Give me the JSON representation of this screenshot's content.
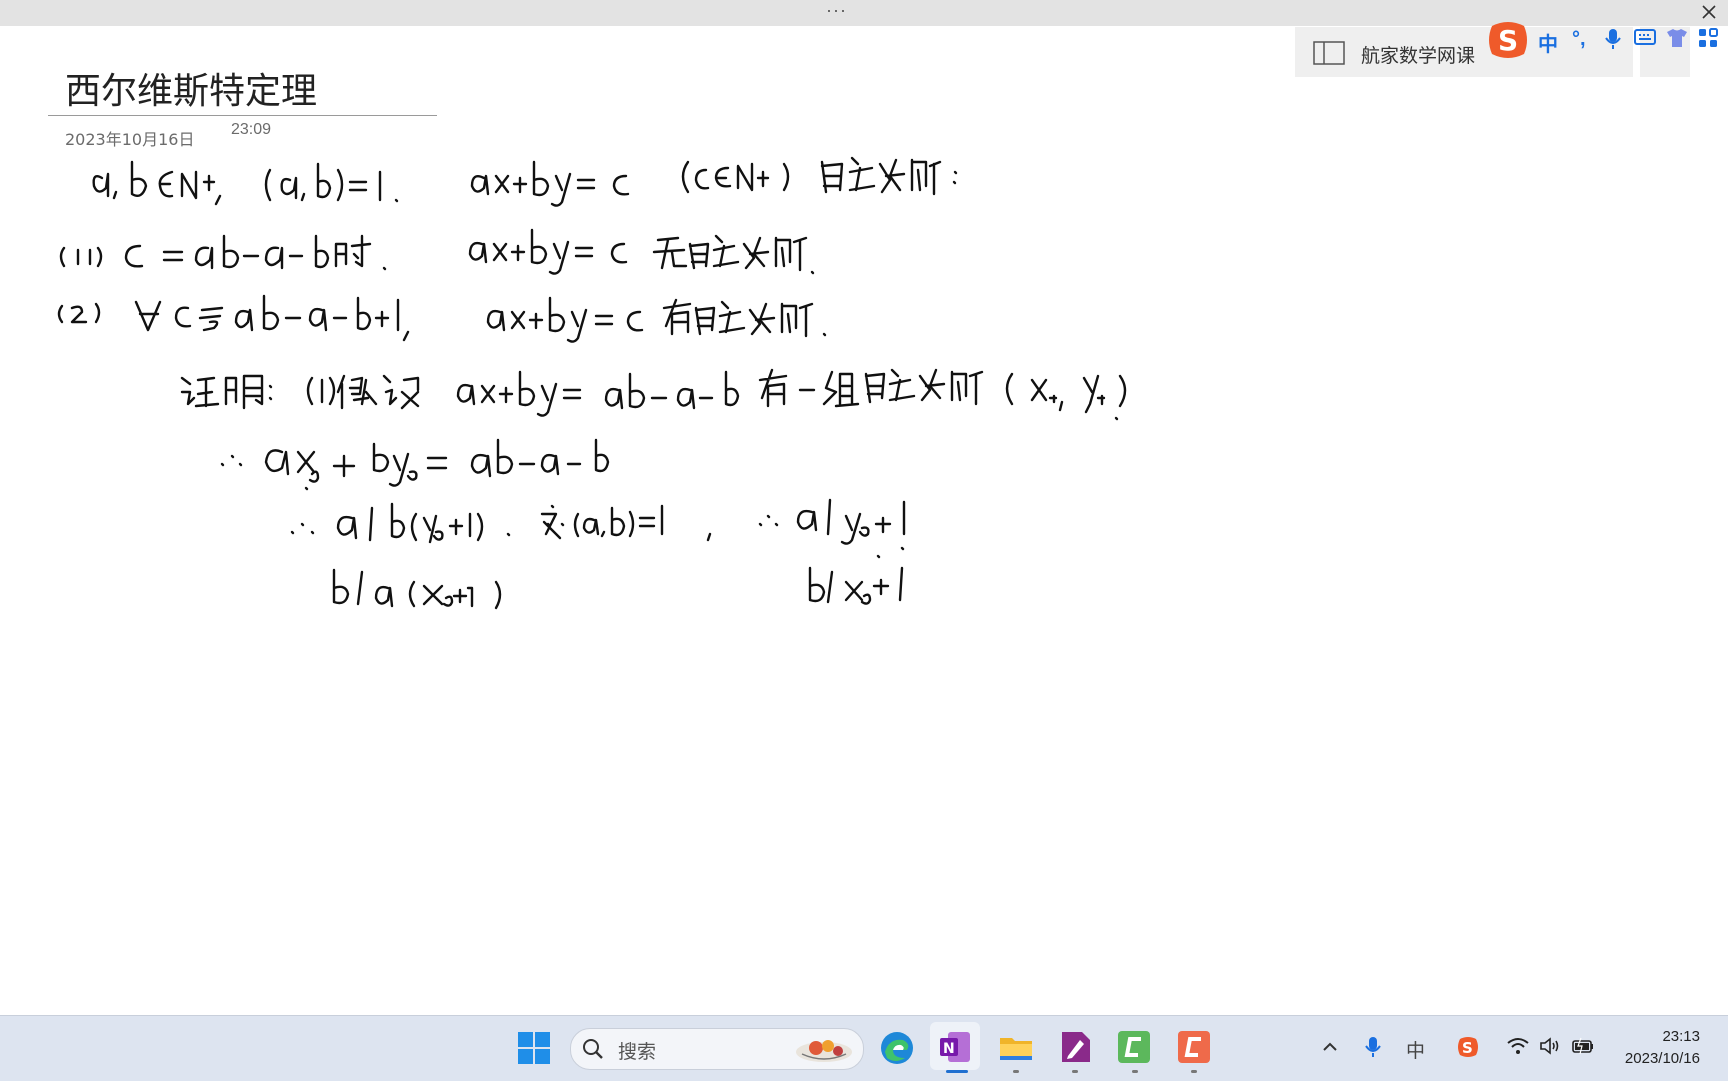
{
  "window": {
    "title_dots": "···",
    "close_label": "close"
  },
  "page": {
    "title": "西尔维斯特定理",
    "date": "2023年10月16日",
    "time": "23:09"
  },
  "notebook": {
    "label": "航家数学网课"
  },
  "ime": {
    "items": [
      "中",
      "°,",
      "mic",
      "keyboard",
      "skin",
      "apps"
    ],
    "mode": "中"
  },
  "handwriting": {
    "lines": [
      "a,b ∈ N+, (a,b)=1.   ax+by=c   (c∈N+) 自然数解:",
      "(1) c = ab−a−b 时,   ax+by=c 无自然数解",
      "(2) ∀ c ≥ ab−a−b+1,   ax+by=c 有自然数解.",
      "证明: (1)假设 ax+by = ab−a−b 有一组自然数解 (x₀, y₀)",
      "∴ ax₀ + by₀ = ab−a−b",
      "∴ a | b(y₀+1).  又∵(a,b)=1,   ∴ a | y₀+1",
      "b | a(x₀+1)   b | x₀+1"
    ]
  },
  "taskbar": {
    "search_placeholder": "搜索",
    "apps": [
      "start",
      "search",
      "edge",
      "onenote",
      "file-explorer",
      "draw-app",
      "green-app",
      "orange-app"
    ],
    "tray": {
      "ime": "中",
      "time": "23:13",
      "date": "2023/10/16"
    }
  },
  "colors": {
    "ink": "#111111",
    "taskbar": "#dde4f0",
    "ime_blue": "#1a6fe0",
    "sogou_orange": "#ef5a2a"
  }
}
